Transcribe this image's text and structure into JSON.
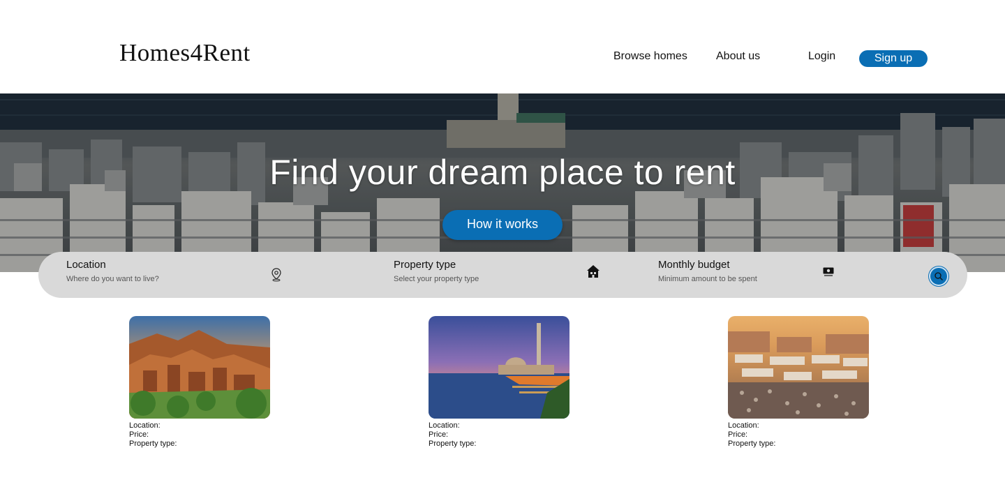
{
  "header": {
    "logo": "Homes4Rent",
    "nav": {
      "browse": "Browse homes",
      "about": "About us",
      "login": "Login",
      "signup": "Sign up"
    }
  },
  "hero": {
    "title": "Find your dream place to rent",
    "button": "How it works"
  },
  "search": {
    "location": {
      "title": "Location",
      "subtitle": "Where do you want to live?",
      "icon": "map-pin-icon"
    },
    "property_type": {
      "title": "Property type",
      "subtitle": "Select your property type",
      "icon": "house-icon"
    },
    "budget": {
      "title": "Monthly budget",
      "subtitle": "Minimum amount to be spent",
      "icon": "money-icon"
    },
    "submit_icon": "search-icon"
  },
  "listings": [
    {
      "location_label": "Location:",
      "price_label": "Price:",
      "type_label": "Property type:"
    },
    {
      "location_label": "Location:",
      "price_label": "Price:",
      "type_label": "Property type:"
    },
    {
      "location_label": "Location:",
      "price_label": "Price:",
      "type_label": "Property type:"
    }
  ],
  "colors": {
    "accent": "#0a6eb4",
    "search_bar": "#d9d9d9"
  }
}
